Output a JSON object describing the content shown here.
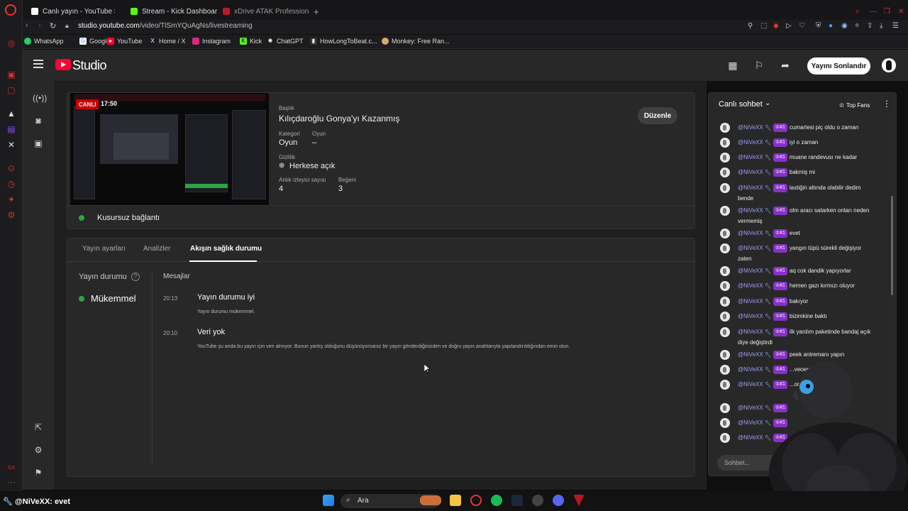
{
  "browser": {
    "tabs": [
      {
        "label": "Canlı yayın - YouTube Stu",
        "color": "#ff0033"
      },
      {
        "label": "Stream - Kick Dashboard",
        "color": "#53fc18"
      },
      {
        "label": "xDrive ATAK Professional",
        "color": "#b8192b"
      }
    ],
    "url_host": "studio.youtube.com",
    "url_path": "/video/TlSmYQuAgNs/livestreaming",
    "bookmarks": [
      "WhatsApp",
      "Google",
      "YouTube",
      "Home / X",
      "Instagram",
      "Kick",
      "ChatGPT",
      "HowLongToBeat.c...",
      "Monkey: Free Ran..."
    ]
  },
  "header": {
    "logo_text": "Studio",
    "end_stream_label": "Yayını Sonlandır"
  },
  "stream": {
    "live_label": "CANLI",
    "live_time": "17:50",
    "title_label": "Başlık",
    "title": "Kılıçdaroğlu Gonya'yı Kazanmış",
    "category_label": "Kategori",
    "category": "Oyun",
    "game_label": "Oyun",
    "game": "–",
    "privacy_label": "Gizlilik",
    "privacy": "Herkese açık",
    "viewers_label": "Anlık izleyici sayısı",
    "viewers": "4",
    "likes_label": "Beğeni",
    "likes": "3",
    "edit_label": "Düzenle",
    "connection": "Kusursuz bağlantı"
  },
  "health": {
    "tabs": [
      "Yayın ayarları",
      "Analizler",
      "Akışın sağlık durumu"
    ],
    "status_heading": "Yayın durumu",
    "status_value": "Mükemmel",
    "messages_heading": "Mesajlar",
    "messages": [
      {
        "time": "20:13",
        "title": "Yayın durumu iyi",
        "desc": "Yayın durumu mükemmel."
      },
      {
        "time": "20:10",
        "title": "Veri yok",
        "desc": "YouTube şu anda bu yayın için veri almıyor. Bunun yanlış olduğunu düşünüyorsanız bir yayın gönderdiğinizden ve doğru yayın anahtarıyla yapılandırıldığından emin olun."
      }
    ]
  },
  "chat": {
    "title": "Canlı sohbet",
    "top_fans": "Top Fans",
    "input_placeholder": "Sohbet...",
    "user": "@NiVeXX",
    "badge": "#1",
    "messages": [
      "cumartesi piç oldu o zaman",
      "iyi o zaman",
      "muane randevusı ne kadar",
      "bakmiş mi",
      "lastiğin altında olabilir dedim bende",
      "olm aracı satarken onları neden vermemiş",
      "evet",
      "yangın tüpü sürekli değişiyor zaten",
      "aq cok dandik yapıyorlar",
      "hemen gazı kırmızı oluyor",
      "bakıyor",
      "bizimkine baktı",
      "ilk yardım paketinde bandaj açık diye değiştirdi",
      "peek antremanı yapın",
      "...vecem",
      "...or koltuk içimçn",
      "",
      "",
      ""
    ]
  },
  "taskbar": {
    "overlay_user": "@NiVeXX",
    "overlay_msg": ": evet",
    "search_placeholder": "Ara"
  }
}
